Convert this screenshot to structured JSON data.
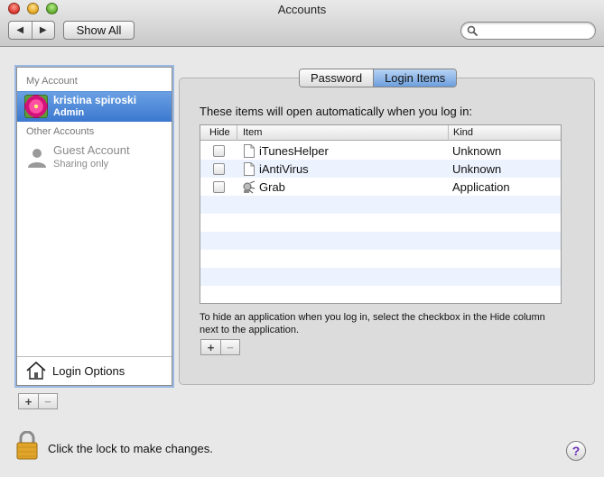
{
  "window": {
    "title": "Accounts"
  },
  "toolbar": {
    "back_glyph": "◀",
    "forward_glyph": "▶",
    "show_all_label": "Show All",
    "search_placeholder": ""
  },
  "sidebar": {
    "my_account_header": "My Account",
    "selected_account": {
      "name": "kristina spiroski",
      "role": "Admin"
    },
    "other_accounts_header": "Other Accounts",
    "guest": {
      "name": "Guest Account",
      "sub": "Sharing only"
    },
    "login_options_label": "Login Options",
    "add_label": "+",
    "remove_label": "−"
  },
  "tabs": [
    {
      "label": "Password",
      "active": false
    },
    {
      "label": "Login Items",
      "active": true
    }
  ],
  "login_items": {
    "intro": "These items will open automatically when you log in:",
    "columns": {
      "hide": "Hide",
      "item": "Item",
      "kind": "Kind"
    },
    "rows": [
      {
        "name": "iTunesHelper",
        "kind": "Unknown",
        "hidden": false,
        "icon": "document-icon"
      },
      {
        "name": "iAntiVirus",
        "kind": "Unknown",
        "hidden": false,
        "icon": "document-icon"
      },
      {
        "name": "Grab",
        "kind": "Application",
        "hidden": false,
        "icon": "grab-app-icon"
      }
    ],
    "help_text": "To hide an application when you log in, select the checkbox in the Hide column next to the application.",
    "add_label": "+",
    "remove_label": "−"
  },
  "footer": {
    "lock_text": "Click the lock to make changes.",
    "help_label": "?"
  },
  "colors": {
    "selection": "#3b78cf",
    "alt_row": "#edf3fe",
    "tab_active": "#6c9fde"
  }
}
